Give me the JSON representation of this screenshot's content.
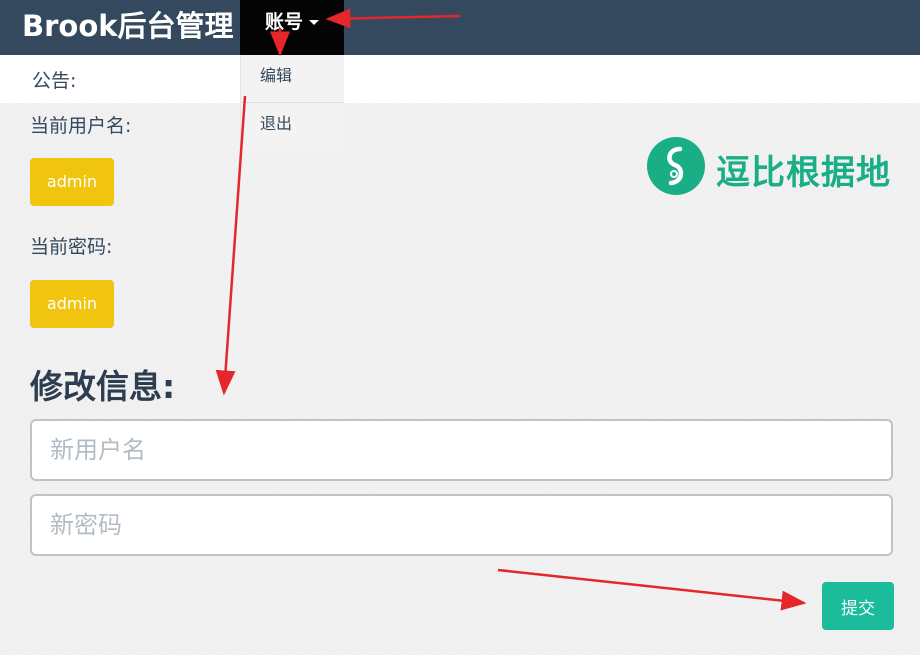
{
  "header": {
    "brand": "Brook后台管理",
    "account_menu_label": "账号"
  },
  "dropdown": {
    "items": [
      {
        "label": "编辑"
      },
      {
        "label": "退出"
      }
    ]
  },
  "notice": {
    "label": "公告:"
  },
  "current": {
    "username_label": "当前用户名:",
    "username_value": "admin",
    "password_label": "当前密码:",
    "password_value": "admin"
  },
  "form": {
    "title": "修改信息:",
    "username_placeholder": "新用户名",
    "password_placeholder": "新密码",
    "submit_label": "提交"
  },
  "watermark": {
    "text": "逗比根据地"
  },
  "colors": {
    "navbar": "#34495e",
    "active_nav": "#040404",
    "badge": "#f1c40f",
    "submit": "#1abc9c",
    "annotation_arrow": "#e5262a"
  }
}
